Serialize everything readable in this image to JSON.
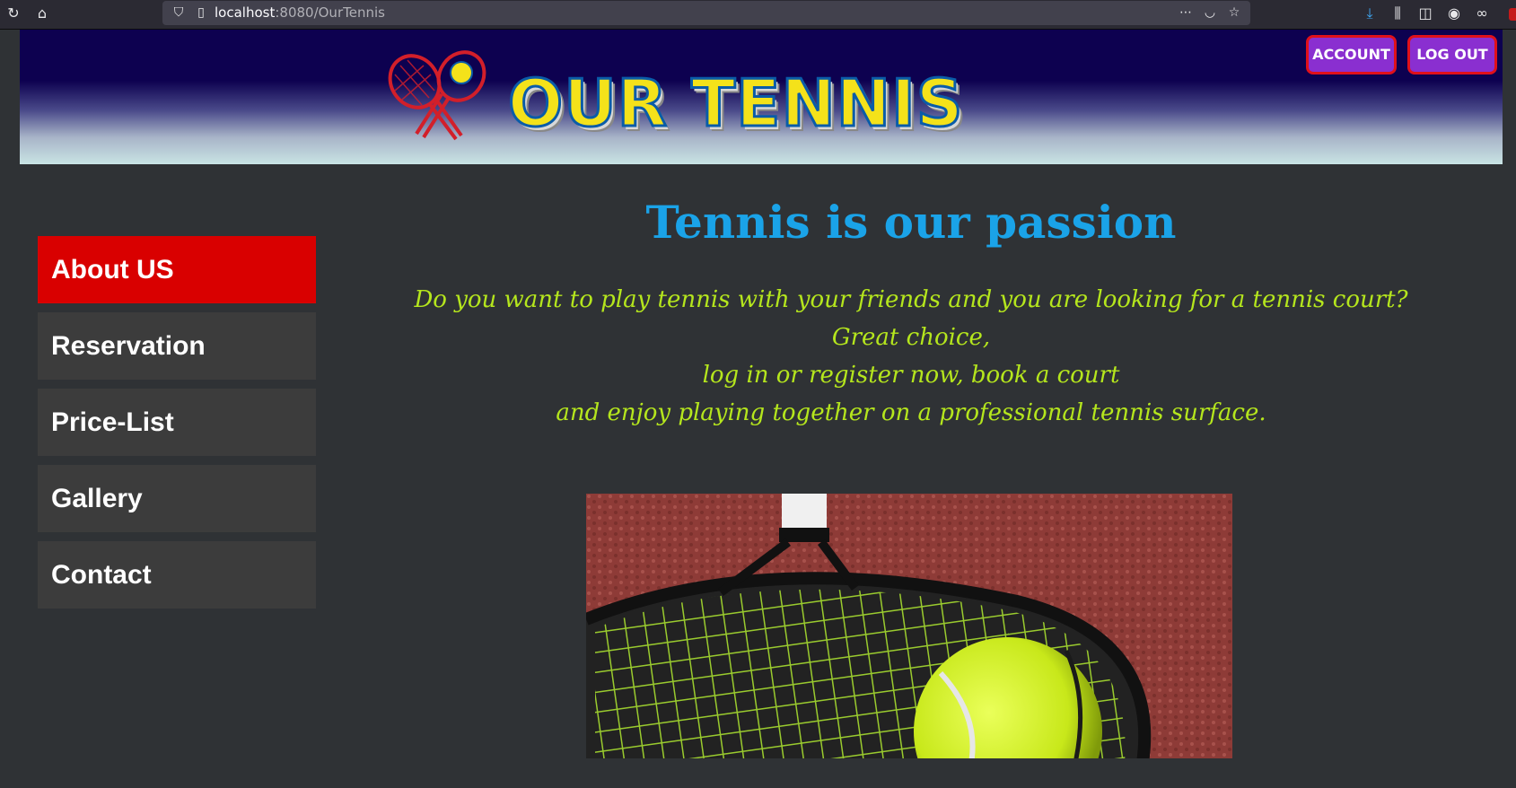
{
  "browser": {
    "url_host": "localhost",
    "url_rest": ":8080/OurTennis",
    "icons": [
      "reload-icon",
      "home-icon",
      "shield-icon",
      "page-icon",
      "more-icon",
      "pocket-icon",
      "bookmark-star-icon",
      "download-icon",
      "library-icon",
      "sidebar-icon",
      "account-icon",
      "extension-icon"
    ]
  },
  "header": {
    "logo_text": "OUR TENNIS",
    "account_label": "ACCOUNT",
    "logout_label": "LOG OUT"
  },
  "sidebar": {
    "items": [
      {
        "label": "About US",
        "active": true
      },
      {
        "label": "Reservation",
        "active": false
      },
      {
        "label": "Price-List",
        "active": false
      },
      {
        "label": "Gallery",
        "active": false
      },
      {
        "label": "Contact",
        "active": false
      }
    ]
  },
  "main": {
    "headline": "Tennis is our passion",
    "intro_lines": [
      "Do you want to play tennis with your friends and you are looking for a tennis court?",
      "Great choice,",
      "log in or register now, book a court",
      "and enjoy playing together on a professional tennis surface."
    ]
  },
  "colors": {
    "active_nav": "#d90000",
    "headline": "#1aa3e8",
    "intro_text": "#b5e61d",
    "button_bg": "#8a2fd0",
    "button_border": "#e0101a"
  }
}
